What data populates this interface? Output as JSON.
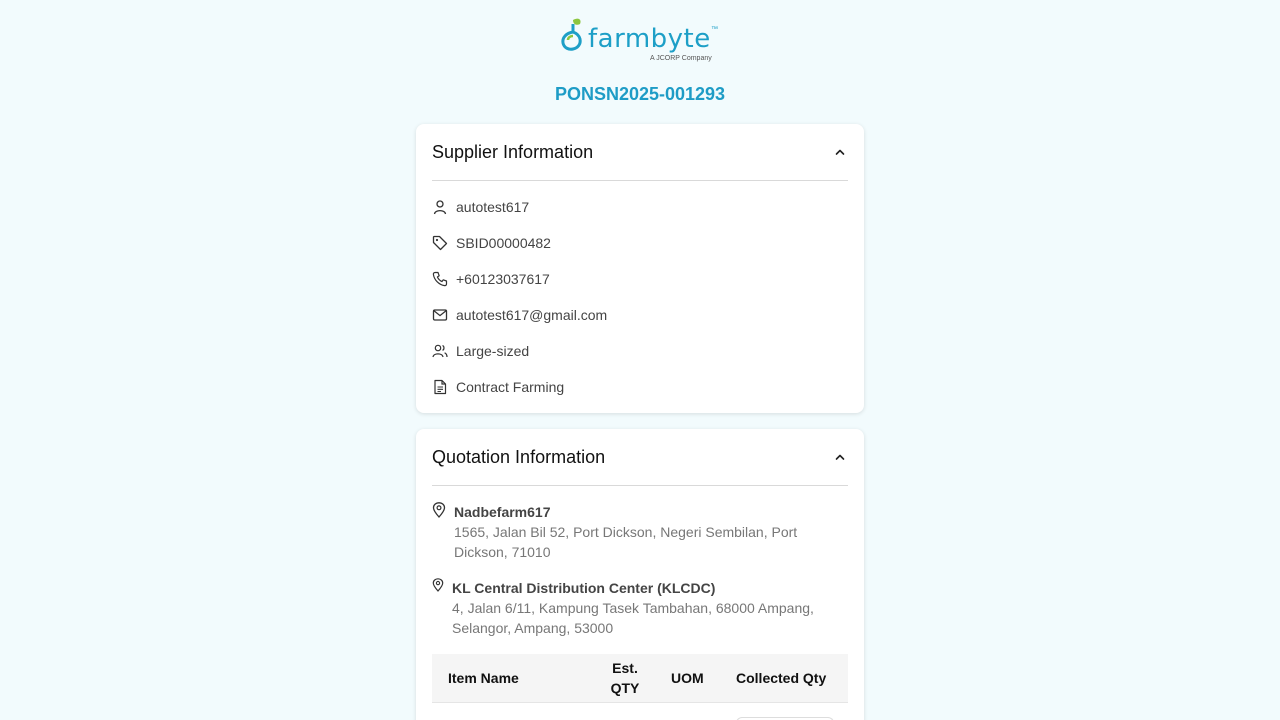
{
  "brand": {
    "name": "farmbyte",
    "tm": "™",
    "tagline": "A JCORP Company",
    "color": "#1d9fc7"
  },
  "po_number": "PONSN2025-001293",
  "supplier": {
    "title": "Supplier Information",
    "rows": [
      {
        "icon": "user-icon",
        "text": "autotest617"
      },
      {
        "icon": "tag-icon",
        "text": "SBID00000482"
      },
      {
        "icon": "phone-icon",
        "text": "+60123037617"
      },
      {
        "icon": "mail-icon",
        "text": "autotest617@gmail.com"
      },
      {
        "icon": "users-icon",
        "text": "Large-sized"
      },
      {
        "icon": "document-icon",
        "text": "Contract Farming"
      }
    ]
  },
  "quotation": {
    "title": "Quotation Information",
    "origin": {
      "name": "Nadbefarm617",
      "address": "1565, Jalan Bil 52, Port Dickson, Negeri Sembilan, Port Dickson, 71010"
    },
    "destination": {
      "name": "KL Central Distribution Center (KLCDC)",
      "address": "4, Jalan 6/11, Kampung Tasek Tambahan, 68000 Ampang, Selangor, Ampang, 53000"
    },
    "table": {
      "headers": [
        "Item Name",
        "Est. QTY",
        "UOM",
        "Collected Qty"
      ]
    }
  }
}
